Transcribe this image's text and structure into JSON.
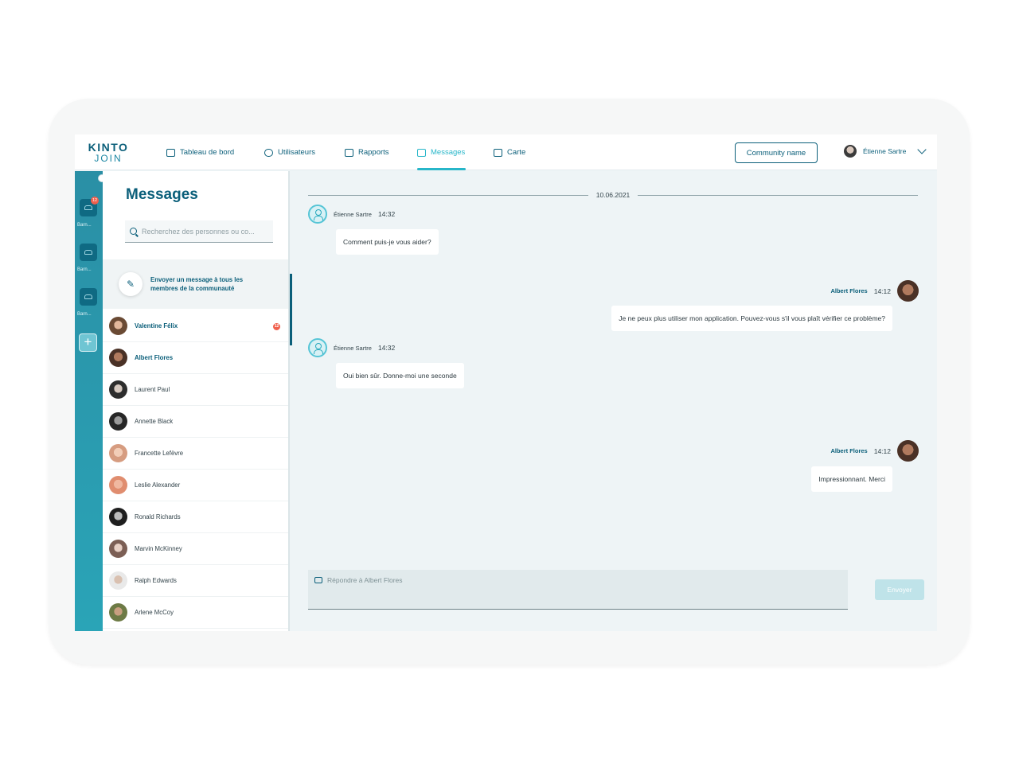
{
  "brand": {
    "line1": "KINTO",
    "line2": "JOIN"
  },
  "nav": [
    {
      "label": "Tableau de bord",
      "icon": "calendar-icon"
    },
    {
      "label": "Utilisateurs",
      "icon": "users-icon"
    },
    {
      "label": "Rapports",
      "icon": "report-icon"
    },
    {
      "label": "Messages",
      "icon": "chat-icon",
      "active": true
    },
    {
      "label": "Carte",
      "icon": "map-icon"
    }
  ],
  "header": {
    "community_button": "Community name",
    "user_name": "Étienne Sartre"
  },
  "rail": {
    "communities": [
      {
        "label": "Barn...",
        "badge": "12"
      },
      {
        "label": "Barn..."
      },
      {
        "label": "Barn..."
      }
    ],
    "add_label": "+"
  },
  "contacts": {
    "title": "Messages",
    "search_placeholder": "Recherchez des personnes ou co...",
    "broadcast_label": "Envoyer un message à tous les membres de la communauté",
    "list": [
      {
        "name": "Valentine Félix",
        "unread": "12"
      },
      {
        "name": "Albert Flores"
      },
      {
        "name": "Laurent Paul"
      },
      {
        "name": "Annette Black"
      },
      {
        "name": "Francette Lefèvre"
      },
      {
        "name": "Leslie Alexander"
      },
      {
        "name": "Ronald Richards"
      },
      {
        "name": "Marvin McKinney"
      },
      {
        "name": "Ralph Edwards"
      },
      {
        "name": "Arlene McCoy"
      }
    ]
  },
  "chat": {
    "date": "10.06.2021",
    "messages": [
      {
        "sender": "Étienne Sartre",
        "time": "14:32",
        "text": "Comment puis-je vous aider?"
      },
      {
        "sender": "Albert Flores",
        "time": "14:12",
        "text": "Je ne peux plus utiliser mon application. Pouvez-vous s'il vous plaît vérifier ce problème?"
      },
      {
        "sender": "Étienne Sartre",
        "time": "14:32",
        "text": "Oui bien sûr. Donne-moi une seconde"
      },
      {
        "sender": "Albert Flores",
        "time": "14:12",
        "text": "Impressionnant. Merci"
      }
    ],
    "reply_placeholder": "Répondre à  Albert Flores",
    "send_label": "Envoyer"
  },
  "colors": {
    "primary": "#0b5f7a",
    "accent": "#27b6c9",
    "badge": "#f0604d",
    "chat_bg": "#eef4f6"
  }
}
